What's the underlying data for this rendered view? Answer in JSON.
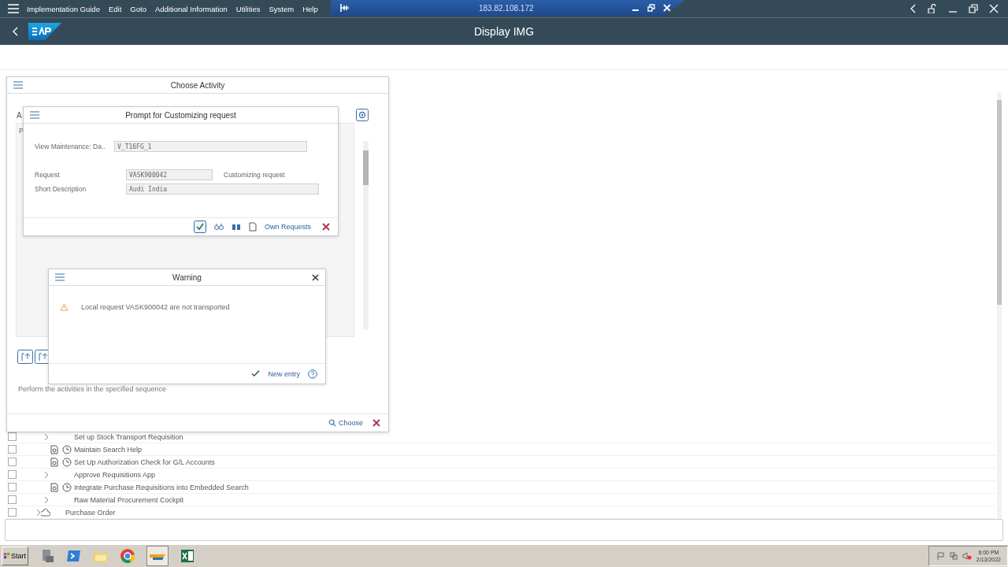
{
  "menu_bar": {
    "items": [
      "Implementation Guide",
      "Edit",
      "Goto",
      "Additional Information",
      "Utilities",
      "System",
      "Help"
    ]
  },
  "remote_session_bar": {
    "address": "183.82.108.172"
  },
  "title_bar": {
    "title": "Display IMG"
  },
  "choose_activity_dialog": {
    "title": "Choose Activity",
    "covered_letters": [
      "A",
      "P"
    ],
    "note": "Perform the activities in the specified sequence",
    "choose_button": "Choose"
  },
  "customizing_prompt": {
    "title": "Prompt for Customizing request",
    "fields": [
      {
        "label": "View Maintenance: Da..",
        "value": "V_T16FG_1"
      },
      {
        "label": "Request",
        "value": "VASK900042",
        "note": "Customizing request"
      },
      {
        "label": "Short Description",
        "value": "Audi India"
      }
    ],
    "own_requests_button": "Own Requests"
  },
  "warning_dialog": {
    "title": "Warning",
    "message": "Local request VASK900042 are not transported",
    "confirm_button": "New entry"
  },
  "tree": {
    "rows": [
      {
        "label": "Set up Stock Transport Requisition",
        "kind": "folder",
        "checked": false
      },
      {
        "label": "Maintain Search Help",
        "kind": "activity",
        "checked": false
      },
      {
        "label": "Set Up Authorization Check for G/L Accounts",
        "kind": "activity",
        "checked": false
      },
      {
        "label": "Approve Requisitions App",
        "kind": "folder",
        "checked": false
      },
      {
        "label": "Integrate Purchase Requisitions into Embedded Search",
        "kind": "activity",
        "checked": false
      },
      {
        "label": "Raw Material Procurement Cockpit",
        "kind": "folder",
        "checked": false
      },
      {
        "label": "Purchase Order",
        "kind": "parent",
        "checked": false
      }
    ]
  },
  "taskbar": {
    "start": "Start",
    "clock": {
      "time": "6:00 PM",
      "date": "2/13/2022"
    }
  }
}
